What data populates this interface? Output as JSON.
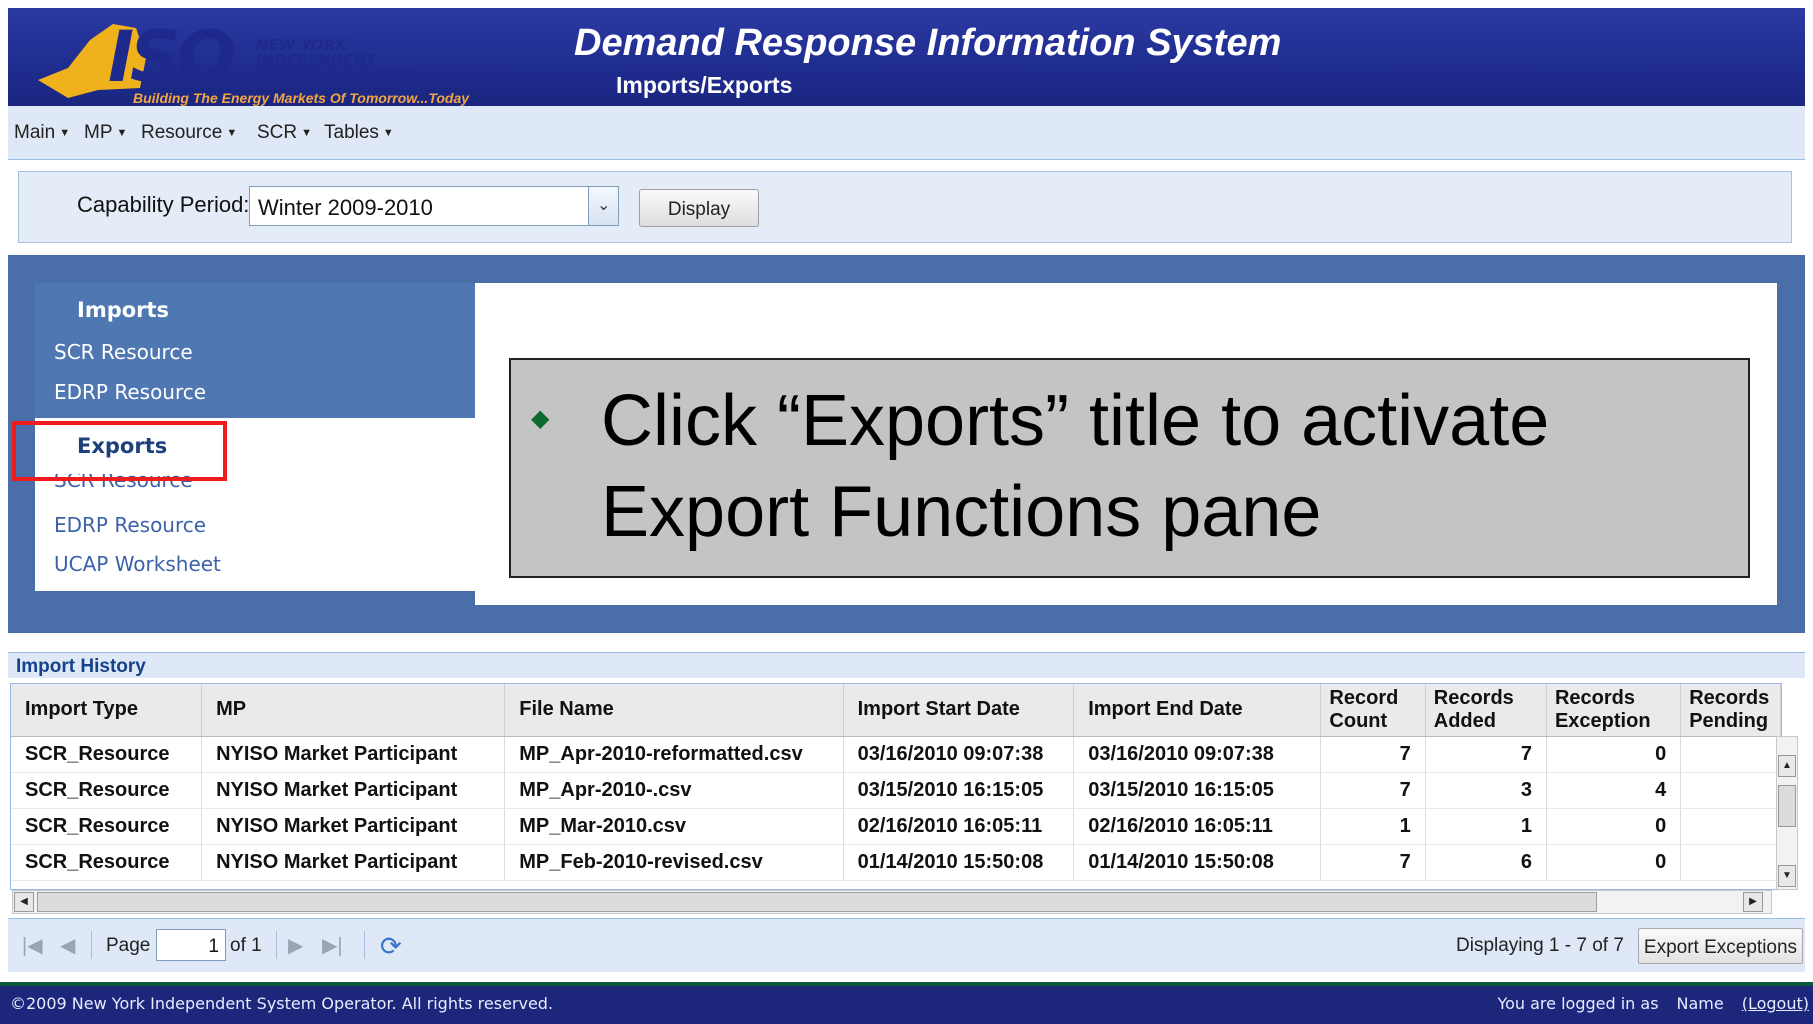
{
  "header": {
    "logo": {
      "iso": "ISO",
      "org_lines": [
        "NEW YORK",
        "INDEPENDENT",
        "SYSTEM OPERATOR"
      ],
      "tagline": "Building The Energy Markets Of Tomorrow...Today"
    },
    "title": "Demand Response Information System",
    "subtitle": "Imports/Exports"
  },
  "menu": {
    "items": [
      {
        "label": "Main"
      },
      {
        "label": "MP"
      },
      {
        "label": "Resource"
      },
      {
        "label": "SCR"
      },
      {
        "label": "Tables"
      }
    ]
  },
  "capability": {
    "label": "Capability Period:",
    "selected": "Winter 2009-2010",
    "display_label": "Display"
  },
  "nav": {
    "imports_title": "Imports",
    "imports_links": [
      "SCR Resource",
      "EDRP Resource"
    ],
    "exports_title": "Exports",
    "exports_links": [
      "SCR Resource",
      "EDRP Resource",
      "UCAP Worksheet"
    ]
  },
  "callout": {
    "text_line1": "Click “Exports” title to activate",
    "text_line2": "Export Functions pane"
  },
  "history": {
    "title": "Import History",
    "columns": [
      "Import Type",
      "MP",
      "File Name",
      "Import Start Date",
      "Import End Date",
      "Record Count",
      "Records Added",
      "Records Exception",
      "Records Pending"
    ],
    "rows": [
      [
        "SCR_Resource",
        "NYISO Market Participant",
        "MP_Apr-2010-reformatted.csv",
        "03/16/2010 09:07:38",
        "03/16/2010 09:07:38",
        "7",
        "7",
        "0",
        ""
      ],
      [
        "SCR_Resource",
        "NYISO Market Participant",
        "MP_Apr-2010-.csv",
        "03/15/2010 16:15:05",
        "03/15/2010 16:15:05",
        "7",
        "3",
        "4",
        ""
      ],
      [
        "SCR_Resource",
        "NYISO Market Participant",
        "MP_Mar-2010.csv",
        "02/16/2010 16:05:11",
        "02/16/2010 16:05:11",
        "1",
        "1",
        "0",
        ""
      ],
      [
        "SCR_Resource",
        "NYISO Market Participant",
        "MP_Feb-2010-revised.csv",
        "01/14/2010 15:50:08",
        "01/14/2010 15:50:08",
        "7",
        "6",
        "0",
        ""
      ]
    ]
  },
  "pager": {
    "page_label": "Page",
    "page_value": "1",
    "of_label": "of 1",
    "display_text": "Displaying 1 - 7 of 7",
    "export_exceptions": "Export Exceptions"
  },
  "footer": {
    "copyright": "©2009   New York Independent System Operator. All rights reserved.",
    "logged_in": "You are logged in as",
    "user": "Name",
    "logout": "(Logout)"
  },
  "colors": {
    "header_bg": "#1f2c8f",
    "accent_red": "#ee1c1c",
    "nav_active": "#1d3f7a",
    "link_light": "#ffffff",
    "link_dark": "#3b62a8"
  }
}
